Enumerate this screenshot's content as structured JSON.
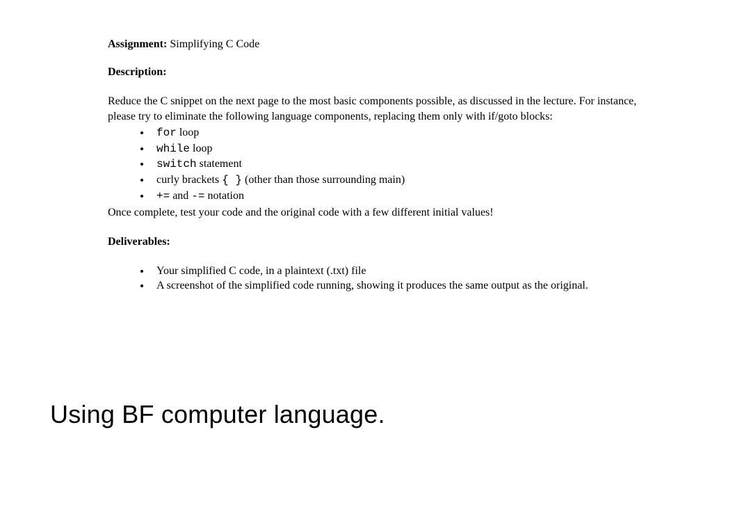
{
  "assignment": {
    "label": "Assignment:",
    "title": "Simplifying C Code"
  },
  "description": {
    "label": "Description:",
    "paragraph": "Reduce the C snippet on the next page to the most basic components possible, as discussed in the lecture. For instance, please try to eliminate the following language components, replacing them only with if/goto blocks:"
  },
  "components": {
    "item1_code": "for",
    "item1_rest": " loop",
    "item2_code": "while",
    "item2_rest": " loop",
    "item3_code": "switch",
    "item3_rest": " statement",
    "item4_pre": "curly brackets ",
    "item4_code": "{  }",
    "item4_rest": " (other than those surrounding main)",
    "item5_code1": "+=",
    "item5_mid": " and ",
    "item5_code2": "-=",
    "item5_rest": " notation"
  },
  "after_components": "Once complete, test your code and the original code with a few different initial values!",
  "deliverables": {
    "label": "Deliverables:",
    "item1": "Your simplified C code, in a plaintext (.txt) file",
    "item2": "A screenshot of the simplified code running, showing it produces the same output as the original."
  },
  "bottom_note": "Using BF computer language."
}
